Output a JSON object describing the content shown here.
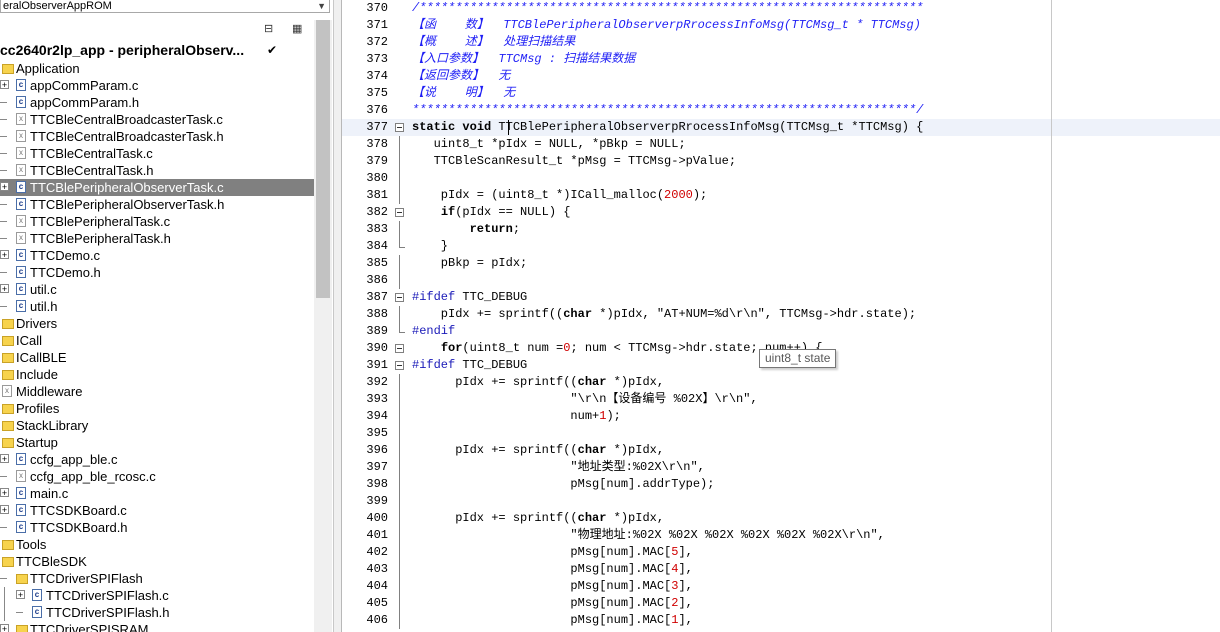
{
  "workspace": {
    "combo_value": "eralObserverAppROM",
    "project": "cc2640r2lp_app - peripheralObserv...",
    "check": "✔",
    "icons": [
      "tree-expand-icon",
      "tree-options-icon"
    ]
  },
  "tree": [
    {
      "label": "Application",
      "type": "folder",
      "indent": 0,
      "exp": ""
    },
    {
      "label": "appCommParam.c",
      "type": "cfile",
      "indent": 1,
      "exp": "+"
    },
    {
      "label": "appCommParam.h",
      "type": "cfile",
      "indent": 1,
      "exp": "-"
    },
    {
      "label": "TTCBleCentralBroadcasterTask.c",
      "type": "xfile",
      "indent": 1,
      "exp": "-"
    },
    {
      "label": "TTCBleCentralBroadcasterTask.h",
      "type": "xfile",
      "indent": 1,
      "exp": "-"
    },
    {
      "label": "TTCBleCentralTask.c",
      "type": "xfile",
      "indent": 1,
      "exp": "-"
    },
    {
      "label": "TTCBleCentralTask.h",
      "type": "xfile",
      "indent": 1,
      "exp": "-"
    },
    {
      "label": "TTCBlePeripheralObserverTask.c",
      "type": "cfile",
      "indent": 1,
      "exp": "+",
      "selected": true
    },
    {
      "label": "TTCBlePeripheralObserverTask.h",
      "type": "cfile",
      "indent": 1,
      "exp": "-"
    },
    {
      "label": "TTCBlePeripheralTask.c",
      "type": "xfile",
      "indent": 1,
      "exp": "-"
    },
    {
      "label": "TTCBlePeripheralTask.h",
      "type": "xfile",
      "indent": 1,
      "exp": "-"
    },
    {
      "label": "TTCDemo.c",
      "type": "cfile",
      "indent": 1,
      "exp": "+"
    },
    {
      "label": "TTCDemo.h",
      "type": "cfile",
      "indent": 1,
      "exp": "-"
    },
    {
      "label": "util.c",
      "type": "cfile",
      "indent": 1,
      "exp": "+"
    },
    {
      "label": "util.h",
      "type": "cfile",
      "indent": 1,
      "exp": "-"
    },
    {
      "label": "Drivers",
      "type": "folder",
      "indent": 0,
      "exp": ""
    },
    {
      "label": "ICall",
      "type": "folder",
      "indent": 0,
      "exp": ""
    },
    {
      "label": "ICallBLE",
      "type": "folder",
      "indent": 0,
      "exp": ""
    },
    {
      "label": "Include",
      "type": "folder",
      "indent": 0,
      "exp": ""
    },
    {
      "label": "Middleware",
      "type": "xfile",
      "indent": 0,
      "exp": ""
    },
    {
      "label": "Profiles",
      "type": "folder",
      "indent": 0,
      "exp": ""
    },
    {
      "label": "StackLibrary",
      "type": "folder",
      "indent": 0,
      "exp": ""
    },
    {
      "label": "Startup",
      "type": "folder",
      "indent": 0,
      "exp": ""
    },
    {
      "label": "ccfg_app_ble.c",
      "type": "cfile",
      "indent": 1,
      "exp": "+"
    },
    {
      "label": "ccfg_app_ble_rcosc.c",
      "type": "xfile",
      "indent": 1,
      "exp": "-"
    },
    {
      "label": "main.c",
      "type": "cfile",
      "indent": 1,
      "exp": "+"
    },
    {
      "label": "TTCSDKBoard.c",
      "type": "cfile",
      "indent": 1,
      "exp": "+"
    },
    {
      "label": "TTCSDKBoard.h",
      "type": "cfile",
      "indent": 1,
      "exp": "-"
    },
    {
      "label": "Tools",
      "type": "folder",
      "indent": 0,
      "exp": ""
    },
    {
      "label": "TTCBleSDK",
      "type": "folder",
      "indent": 0,
      "exp": ""
    },
    {
      "label": "TTCDriverSPIFlash",
      "type": "folder",
      "indent": 1,
      "exp": "-"
    },
    {
      "label": "TTCDriverSPIFlash.c",
      "type": "cfile",
      "indent": 2,
      "exp": "+"
    },
    {
      "label": "TTCDriverSPIFlash.h",
      "type": "cfile",
      "indent": 2,
      "exp": "-"
    },
    {
      "label": "TTCDriverSPISRAM",
      "type": "folder",
      "indent": 1,
      "exp": "+"
    }
  ],
  "editor": {
    "tooltip": "uint8_t state",
    "lines": [
      {
        "n": "370",
        "fold": "",
        "parts": [
          [
            "cm",
            "/**********************************************************************"
          ]
        ]
      },
      {
        "n": "371",
        "fold": "",
        "parts": [
          [
            "cm",
            "【函    数】  TTCBlePeripheralObserverpRrocessInfoMsg(TTCMsg_t * TTCMsg)"
          ]
        ]
      },
      {
        "n": "372",
        "fold": "",
        "parts": [
          [
            "cm",
            "【概    述】  处理扫描结果"
          ]
        ]
      },
      {
        "n": "373",
        "fold": "",
        "parts": [
          [
            "cm",
            "【入口参数】  TTCMsg : 扫描结果数据"
          ]
        ]
      },
      {
        "n": "374",
        "fold": "",
        "parts": [
          [
            "cm",
            "【返回参数】  无"
          ]
        ]
      },
      {
        "n": "375",
        "fold": "",
        "parts": [
          [
            "cm",
            "【说    明】  无"
          ]
        ]
      },
      {
        "n": "376",
        "fold": "",
        "parts": [
          [
            "cm",
            "**********************************************************************/"
          ]
        ]
      },
      {
        "n": "377",
        "fold": "box",
        "cur": true,
        "parts": [
          [
            "kw",
            "static"
          ],
          [
            "",
            " "
          ],
          [
            "kw",
            "void"
          ],
          [
            "",
            " TTCBlePeripheralObserverpRrocessInfoMsg(TTCMsg_t *TTCMsg) {"
          ]
        ]
      },
      {
        "n": "378",
        "fold": "line",
        "parts": [
          [
            "",
            "   uint8_t *pIdx = NULL, *pBkp = NULL;"
          ]
        ]
      },
      {
        "n": "379",
        "fold": "line",
        "parts": [
          [
            "",
            "   TTCBleScanResult_t *pMsg = TTCMsg->pValue;"
          ]
        ]
      },
      {
        "n": "380",
        "fold": "line",
        "parts": [
          [
            "",
            ""
          ]
        ]
      },
      {
        "n": "381",
        "fold": "line",
        "parts": [
          [
            "",
            "    pIdx = (uint8_t *)ICall_malloc("
          ],
          [
            "num",
            "2000"
          ],
          [
            "",
            ");"
          ]
        ]
      },
      {
        "n": "382",
        "fold": "box",
        "parts": [
          [
            "",
            "    "
          ],
          [
            "kw",
            "if"
          ],
          [
            "",
            "(pIdx == NULL) {"
          ]
        ]
      },
      {
        "n": "383",
        "fold": "line",
        "parts": [
          [
            "",
            "        "
          ],
          [
            "kw",
            "return"
          ],
          [
            "",
            ";"
          ]
        ]
      },
      {
        "n": "384",
        "fold": "end",
        "parts": [
          [
            "",
            "    }"
          ]
        ]
      },
      {
        "n": "385",
        "fold": "line",
        "parts": [
          [
            "",
            "    pBkp = pIdx;"
          ]
        ]
      },
      {
        "n": "386",
        "fold": "line",
        "parts": [
          [
            "",
            ""
          ]
        ]
      },
      {
        "n": "387",
        "fold": "box",
        "parts": [
          [
            "pp",
            "#ifdef"
          ],
          [
            "",
            " TTC_DEBUG"
          ]
        ]
      },
      {
        "n": "388",
        "fold": "line",
        "parts": [
          [
            "",
            "    pIdx += sprintf(("
          ],
          [
            "kw",
            "char"
          ],
          [
            "",
            " *)pIdx, \"AT+NUM=%d\\r\\n\", TTCMsg->hdr.state);"
          ]
        ]
      },
      {
        "n": "389",
        "fold": "end",
        "parts": [
          [
            "pp",
            "#endif"
          ]
        ]
      },
      {
        "n": "390",
        "fold": "box",
        "parts": [
          [
            "",
            "    "
          ],
          [
            "kw",
            "for"
          ],
          [
            "",
            "(uint8_t num ="
          ],
          [
            "num",
            "0"
          ],
          [
            "",
            "; num < TTCMsg->hdr.state; num++) {"
          ]
        ]
      },
      {
        "n": "391",
        "fold": "box",
        "parts": [
          [
            "pp",
            "#ifdef"
          ],
          [
            "",
            " TTC_DEBUG"
          ]
        ]
      },
      {
        "n": "392",
        "fold": "line",
        "parts": [
          [
            "",
            "      pIdx += sprintf(("
          ],
          [
            "kw",
            "char"
          ],
          [
            "",
            " *)pIdx,"
          ]
        ]
      },
      {
        "n": "393",
        "fold": "line",
        "parts": [
          [
            "",
            "                      \"\\r\\n【设备编号 %02X】\\r\\n\","
          ]
        ]
      },
      {
        "n": "394",
        "fold": "line",
        "parts": [
          [
            "",
            "                      num+"
          ],
          [
            "num",
            "1"
          ],
          [
            "",
            ");"
          ]
        ]
      },
      {
        "n": "395",
        "fold": "line",
        "parts": [
          [
            "",
            ""
          ]
        ]
      },
      {
        "n": "396",
        "fold": "line",
        "parts": [
          [
            "",
            "      pIdx += sprintf(("
          ],
          [
            "kw",
            "char"
          ],
          [
            "",
            " *)pIdx,"
          ]
        ]
      },
      {
        "n": "397",
        "fold": "line",
        "parts": [
          [
            "",
            "                      \"地址类型:%02X\\r\\n\","
          ]
        ]
      },
      {
        "n": "398",
        "fold": "line",
        "parts": [
          [
            "",
            "                      pMsg[num].addrType);"
          ]
        ]
      },
      {
        "n": "399",
        "fold": "line",
        "parts": [
          [
            "",
            ""
          ]
        ]
      },
      {
        "n": "400",
        "fold": "line",
        "parts": [
          [
            "",
            "      pIdx += sprintf(("
          ],
          [
            "kw",
            "char"
          ],
          [
            "",
            " *)pIdx,"
          ]
        ]
      },
      {
        "n": "401",
        "fold": "line",
        "parts": [
          [
            "",
            "                      \"物理地址:%02X %02X %02X %02X %02X %02X\\r\\n\","
          ]
        ]
      },
      {
        "n": "402",
        "fold": "line",
        "parts": [
          [
            "",
            "                      pMsg[num].MAC["
          ],
          [
            "num",
            "5"
          ],
          [
            "",
            "],"
          ]
        ]
      },
      {
        "n": "403",
        "fold": "line",
        "parts": [
          [
            "",
            "                      pMsg[num].MAC["
          ],
          [
            "num",
            "4"
          ],
          [
            "",
            "],"
          ]
        ]
      },
      {
        "n": "404",
        "fold": "line",
        "parts": [
          [
            "",
            "                      pMsg[num].MAC["
          ],
          [
            "num",
            "3"
          ],
          [
            "",
            "],"
          ]
        ]
      },
      {
        "n": "405",
        "fold": "line",
        "parts": [
          [
            "",
            "                      pMsg[num].MAC["
          ],
          [
            "num",
            "2"
          ],
          [
            "",
            "],"
          ]
        ]
      },
      {
        "n": "406",
        "fold": "line",
        "parts": [
          [
            "",
            "                      pMsg[num].MAC["
          ],
          [
            "num",
            "1"
          ],
          [
            "",
            "],"
          ]
        ]
      }
    ]
  }
}
